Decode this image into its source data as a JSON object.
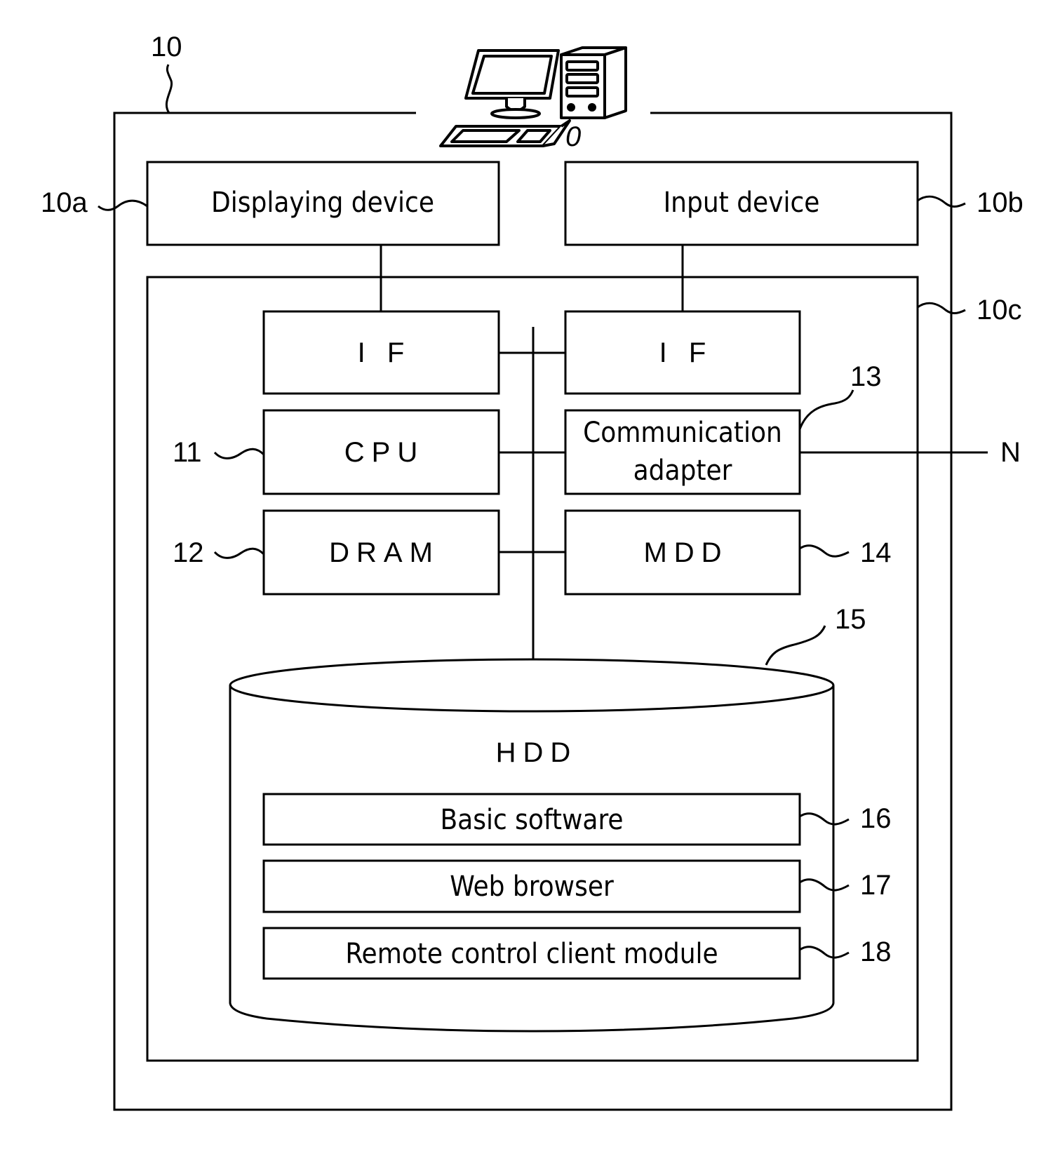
{
  "figure": {
    "refs": {
      "computer": "10",
      "displaying_device": "10a",
      "input_device": "10b",
      "main_unit": "10c",
      "cpu": "11",
      "dram": "12",
      "communication_adapter": "13",
      "mdd": "14",
      "hdd": "15",
      "basic_software": "16",
      "web_browser": "17",
      "remote_control_client_module": "18",
      "network": "N",
      "computer_icon_ref": "0"
    },
    "blocks": {
      "displaying_device": "Displaying device",
      "input_device": "Input device",
      "if_left": "I F",
      "if_right": "I F",
      "cpu": "CPU",
      "communication_adapter_line1": "Communication",
      "communication_adapter_line2": "adapter",
      "dram": "DRAM",
      "mdd": "MDD",
      "hdd": "HDD",
      "basic_software": "Basic software",
      "web_browser": "Web browser",
      "remote_control_client_module": "Remote control client module"
    },
    "icons": {
      "computer": "desktop-computer-icon"
    }
  }
}
